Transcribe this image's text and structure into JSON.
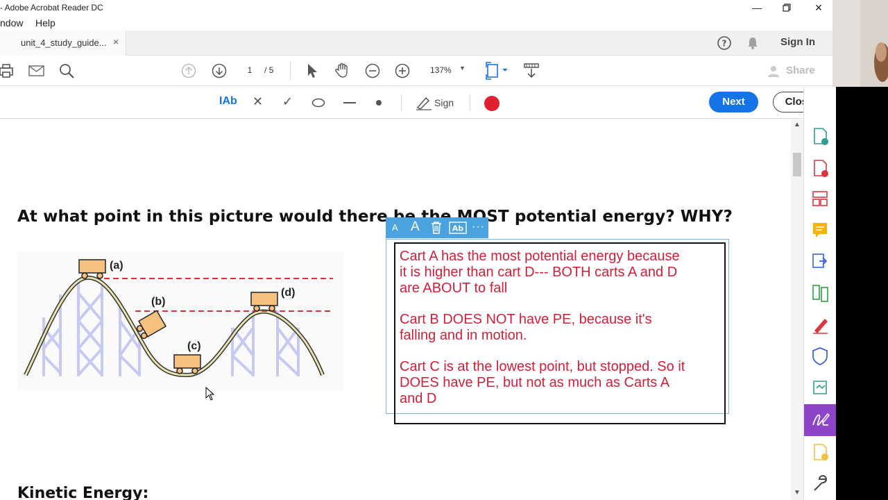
{
  "window": {
    "title": "- Adobe Acrobat Reader DC"
  },
  "menu": [
    "ndow",
    "Help"
  ],
  "tab": {
    "label": "unit_4_study_guide...",
    "close": "×"
  },
  "header_right": {
    "sign_in": "Sign In"
  },
  "toolbar": {
    "page_current": "1",
    "page_total": "/ 5",
    "zoom": "137%",
    "share": "Share"
  },
  "signbar": {
    "text_tool": "IAb",
    "sign_label": "Sign",
    "next": "Next",
    "close": "Close",
    "record_color": "#e0202e"
  },
  "document": {
    "question": "At what point in this picture would there be the MOST potential energy? WHY?",
    "next_heading": "Kinetic Energy:",
    "diagram_labels": {
      "a": "(a)",
      "b": "(b)",
      "c": "(c)",
      "d": "(d)"
    },
    "annotation_paragraphs": [
      "Cart A has the most potential energy because it is higher than cart D--- BOTH carts A and D are ABOUT to fall",
      "Cart B DOES NOT have PE, because it's falling and in motion.",
      "Cart C is at the lowest point, but stopped. So it DOES have PE, but not as much as Carts A and D"
    ],
    "annotation_lines": [
      [
        "Cart A has the most potential energy because",
        "it is higher than cart D--- BOTH carts A and D",
        "are ABOUT to fall"
      ],
      [
        "Cart B DOES NOT have PE, because it's",
        "falling and in motion."
      ],
      [
        "Cart C is at the lowest point, but stopped. So it",
        "DOES have PE, but not as much as Carts A",
        "and D"
      ]
    ]
  },
  "colors": {
    "accent": "#1473e6",
    "annotation_text": "#d0203a",
    "annotation_toolbar": "#4aa3df",
    "rightpane_active": "#8e44c9"
  }
}
